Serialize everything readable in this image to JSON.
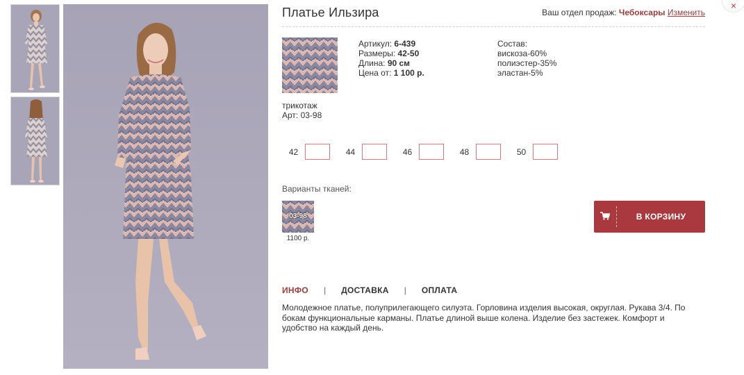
{
  "product": {
    "title": "Платье Ильзира"
  },
  "region": {
    "prefix": "Ваш отдел продаж:",
    "city": "Чебоксары",
    "change_label": "Изменить"
  },
  "specs": {
    "article_label": "Артикул:",
    "article_value": "6-439",
    "sizes_label": "Размеры:",
    "sizes_value": "42-50",
    "length_label": "Длина:",
    "length_value": "90 см",
    "price_label": "Цена от:",
    "price_value": "1 100 р."
  },
  "composition": {
    "title": "Состав:",
    "items": [
      "вискоза-60%",
      "полиэстер-35%",
      "эластан-5%"
    ]
  },
  "fabric": {
    "type": "трикотаж",
    "article": "Арт: 03-98"
  },
  "sizes": [
    {
      "label": "42",
      "value": ""
    },
    {
      "label": "44",
      "value": ""
    },
    {
      "label": "46",
      "value": ""
    },
    {
      "label": "48",
      "value": ""
    },
    {
      "label": "50",
      "value": ""
    }
  ],
  "variants": {
    "label": "Варианты тканей:",
    "items": [
      {
        "code": "03-98",
        "price": "1100 р."
      }
    ]
  },
  "cart": {
    "label": "В КОРЗИНУ",
    "icon": "cart-icon"
  },
  "close": {
    "label": "×",
    "icon": "close-icon"
  },
  "tabs": [
    {
      "label": "ИНФО",
      "active": true
    },
    {
      "label": "ДОСТАВКА",
      "active": false
    },
    {
      "label": "ОПЛАТА",
      "active": false
    }
  ],
  "tab_separator": "|",
  "description": "Молодежное платье, полуприлегающего силуэта. Горловина изделия высокая, округлая. Рукава 3/4. По бокам функциональные карманы. Платье длиной выше колена. Изделие без застежек. Комфорт и удобство на каждый день.",
  "colors": {
    "accent": "#9c3d3f",
    "button": "#a9393e",
    "photo_bg": "#a8a4b8",
    "fabric_pink": "#e6b7ae",
    "fabric_grey": "#8a87a0"
  }
}
